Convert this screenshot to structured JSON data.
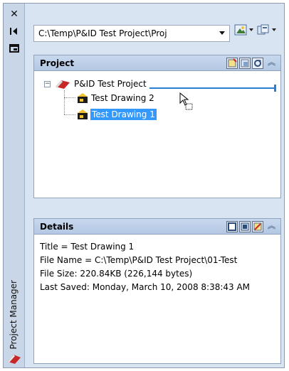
{
  "sidebar": {
    "title": "Project Manager",
    "close_icon": "close-icon",
    "autohide_icon": "autohide-icon",
    "properties_icon": "properties-icon"
  },
  "toolbar": {
    "project_path": "C:\\Temp\\P&ID Test Project\\Proj"
  },
  "project_section": {
    "title": "Project",
    "tree": {
      "root": "P&ID Test Project",
      "children": [
        "Test Drawing 2",
        "Test Drawing 1"
      ],
      "selected": "Test Drawing 1"
    }
  },
  "details_section": {
    "title": "Details",
    "lines": [
      "Title = Test Drawing 1",
      "File Name = C:\\Temp\\P&ID Test Project\\01-Test",
      "File Size: 220.84KB (226,144 bytes)",
      "Last Saved: Monday, March 10, 2008 8:38:43 AM"
    ]
  },
  "colors": {
    "selection": "#3399ff",
    "drop_line": "#2a7fd4",
    "panel_bg": "#d9e4f2"
  }
}
